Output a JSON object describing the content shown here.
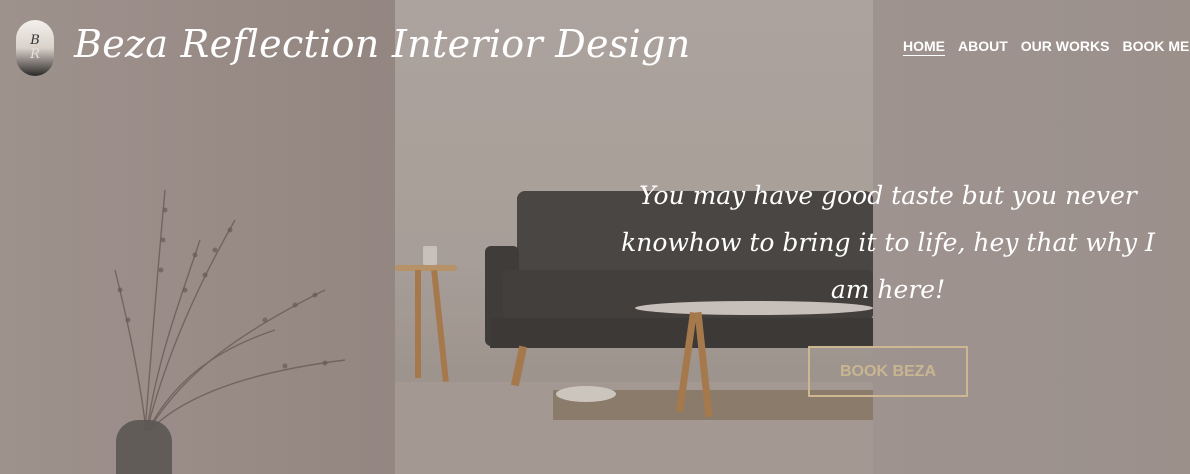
{
  "brand": {
    "logo_letters": [
      "B",
      "R"
    ],
    "name": "Beza Reflection Interior Design"
  },
  "nav": {
    "items": [
      {
        "label": "HOME",
        "active": true
      },
      {
        "label": "ABOUT",
        "active": false
      },
      {
        "label": "OUR WORKS",
        "active": false
      },
      {
        "label": "BOOK ME",
        "active": false
      }
    ]
  },
  "hero": {
    "tagline": "You may have good taste but you never knowhow to bring it to life, hey that why I am here!",
    "cta_label": "BOOK BEZA"
  },
  "colors": {
    "cta_border": "#cdb793",
    "cta_text": "#c8b591",
    "text": "#ffffff"
  }
}
